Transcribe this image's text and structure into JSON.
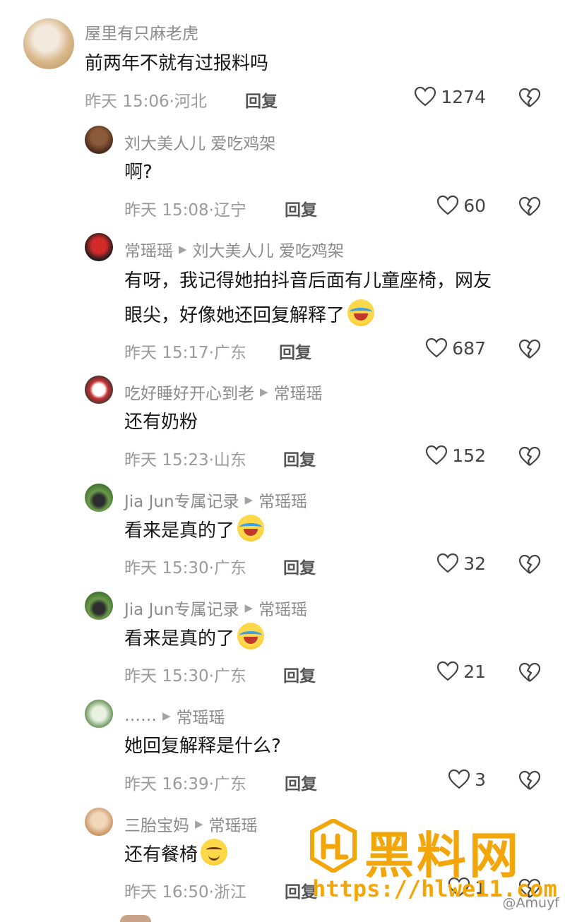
{
  "comments": [
    {
      "user": "屋里有只麻老虎",
      "reply_to": "",
      "text": "前两年不就有过报料吗",
      "emoji": "",
      "time": "昨天 15:06",
      "location": "河北",
      "reply_label": "回复",
      "likes": "1274"
    },
    {
      "user": "刘大美人儿 爱吃鸡架",
      "reply_to": "",
      "text": "啊?",
      "emoji": "",
      "time": "昨天 15:08",
      "location": "辽宁",
      "reply_label": "回复",
      "likes": "60"
    },
    {
      "user": "常瑶瑶",
      "reply_to": "刘大美人儿 爱吃鸡架",
      "text_line1": "有呀，我记得她拍抖音后面有儿童座椅，网友",
      "text": "眼尖，好像她还回复解释了",
      "emoji": "cry-laugh",
      "time": "昨天 15:17",
      "location": "广东",
      "reply_label": "回复",
      "likes": "687"
    },
    {
      "user": "吃好睡好开心到老",
      "reply_to": "常瑶瑶",
      "text": "还有奶粉",
      "emoji": "",
      "time": "昨天 15:23",
      "location": "山东",
      "reply_label": "回复",
      "likes": "152"
    },
    {
      "user": "Jia Jun专属记录",
      "reply_to": "常瑶瑶",
      "text": "看来是真的了",
      "emoji": "cry-laugh",
      "time": "昨天 15:30",
      "location": "广东",
      "reply_label": "回复",
      "likes": "32"
    },
    {
      "user": "Jia Jun专属记录",
      "reply_to": "常瑶瑶",
      "text": "看来是真的了",
      "emoji": "cry-laugh",
      "time": "昨天 15:30",
      "location": "广东",
      "reply_label": "回复",
      "likes": "21"
    },
    {
      "user": "……",
      "reply_to": "常瑶瑶",
      "text": "她回复解释是什么?",
      "emoji": "",
      "time": "昨天 16:39",
      "location": "广东",
      "reply_label": "回复",
      "likes": "3"
    },
    {
      "user": "三胎宝妈",
      "reply_to": "常瑶瑶",
      "text": "还有餐椅",
      "emoji": "smirk",
      "time": "昨天 16:50",
      "location": "浙江",
      "reply_label": "回复",
      "likes": "1"
    }
  ],
  "watermark": {
    "title": "黑料网",
    "url": "https://hlwe11.com",
    "weibo": "@Amuyf"
  },
  "colors": {
    "accent": "#f3a60a",
    "meta_gray": "#9a9a9a",
    "name_gray": "#8b8b8b"
  }
}
